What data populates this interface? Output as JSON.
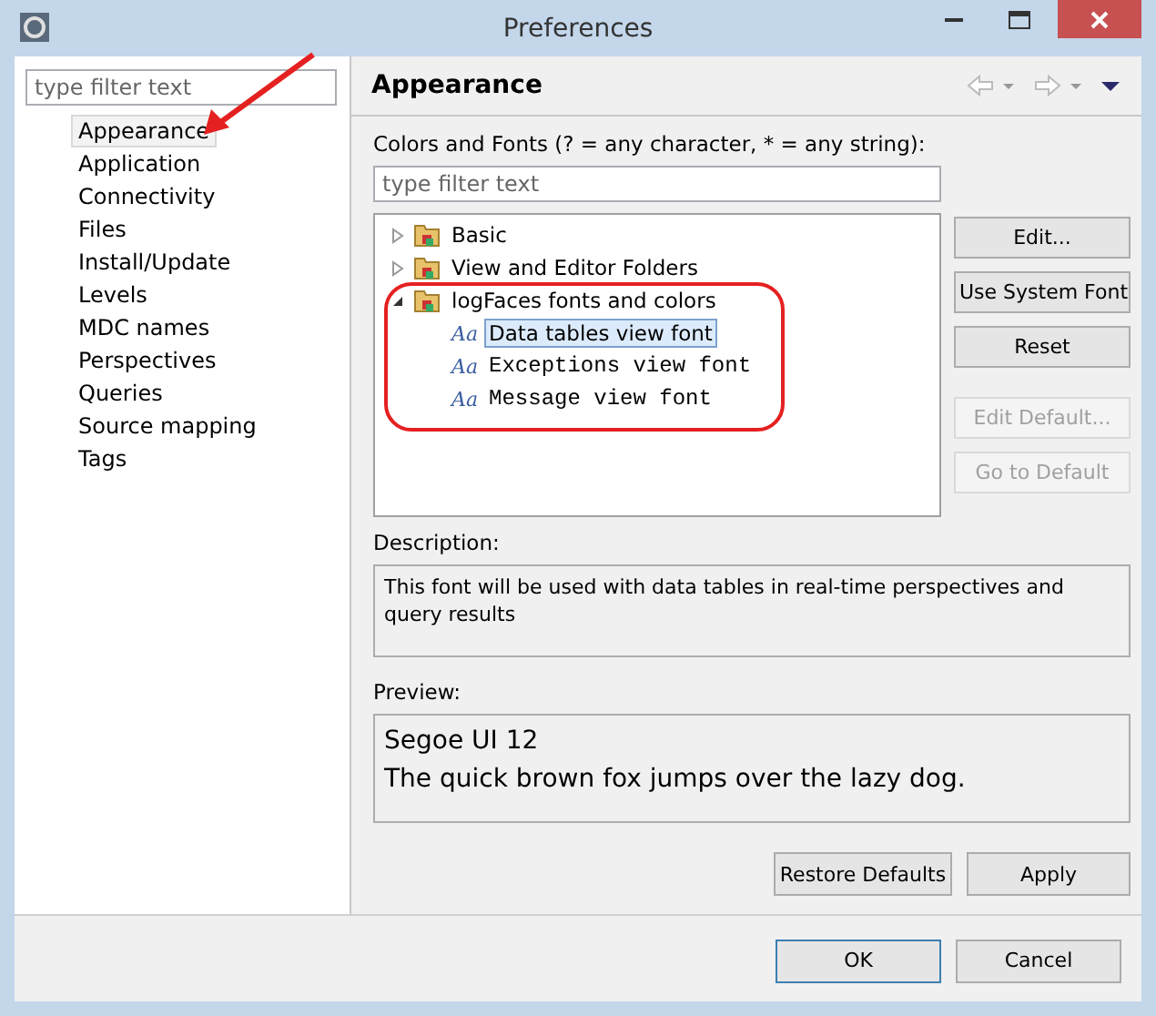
{
  "window": {
    "title": "Preferences"
  },
  "nav_filter": {
    "placeholder": "type filter text"
  },
  "nav_items": [
    {
      "label": "Appearance",
      "selected": true
    },
    {
      "label": "Application",
      "selected": false
    },
    {
      "label": "Connectivity",
      "selected": false
    },
    {
      "label": "Files",
      "selected": false
    },
    {
      "label": "Install/Update",
      "selected": false
    },
    {
      "label": "Levels",
      "selected": false
    },
    {
      "label": "MDC names",
      "selected": false
    },
    {
      "label": "Perspectives",
      "selected": false
    },
    {
      "label": "Queries",
      "selected": false
    },
    {
      "label": "Source mapping",
      "selected": false
    },
    {
      "label": "Tags",
      "selected": false
    }
  ],
  "page": {
    "title": "Appearance"
  },
  "colors_fonts": {
    "label": "Colors and Fonts (? = any character, * = any string):",
    "filter_placeholder": "type filter text",
    "tree": [
      {
        "label": "Basic",
        "expanded": false
      },
      {
        "label": "View and Editor Folders",
        "expanded": false
      },
      {
        "label": "logFaces fonts and colors",
        "expanded": true,
        "children": [
          {
            "icon": "Aa",
            "label": "Data tables view font",
            "kind": "sans",
            "selected": true
          },
          {
            "icon": "Aa",
            "label": "Exceptions view font",
            "kind": "mono",
            "selected": false
          },
          {
            "icon": "Aa",
            "label": "Message view font",
            "kind": "mono",
            "selected": false
          }
        ]
      }
    ],
    "buttons": [
      {
        "label": "Edit...",
        "disabled": false
      },
      {
        "label": "Use System Font",
        "disabled": false
      },
      {
        "label": "Reset",
        "disabled": false
      },
      {
        "label": "Edit Default...",
        "disabled": true
      },
      {
        "label": "Go to Default",
        "disabled": true
      }
    ]
  },
  "description": {
    "label": "Description:",
    "text": "This font will be used with data tables in real-time perspectives and query results"
  },
  "preview": {
    "label": "Preview:",
    "lines": [
      "Segoe UI 12",
      "The quick brown fox jumps over the lazy dog."
    ]
  },
  "page_buttons": [
    "Restore Defaults",
    "Apply"
  ],
  "dialog_buttons": [
    "OK",
    "Cancel"
  ]
}
